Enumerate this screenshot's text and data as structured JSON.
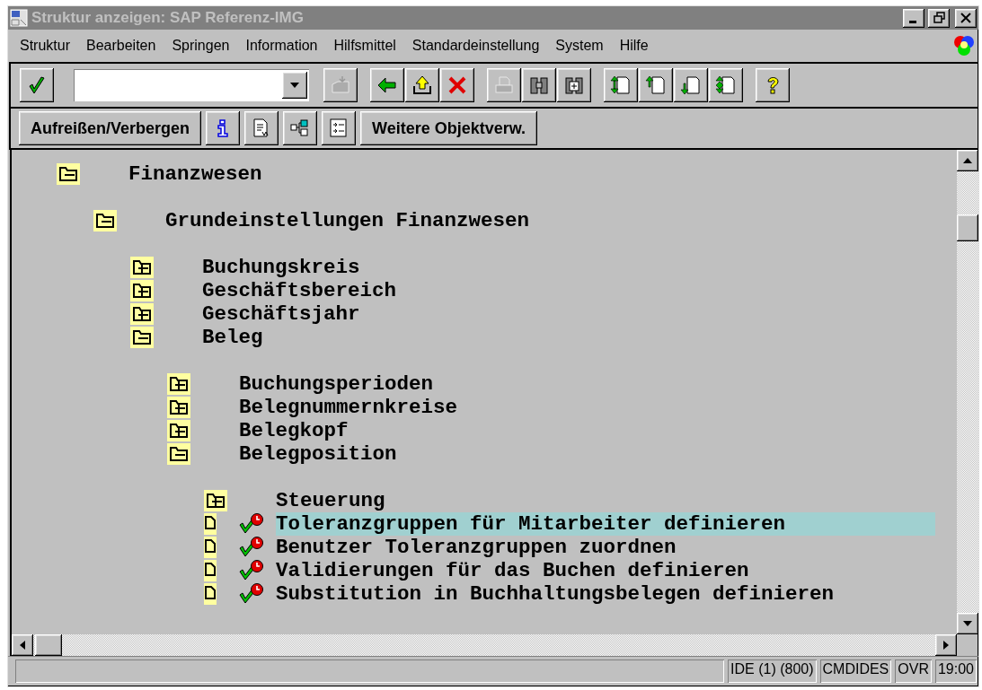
{
  "window": {
    "title": "Struktur anzeigen: SAP Referenz-IMG"
  },
  "menu": [
    {
      "label": "Struktur"
    },
    {
      "label": "Bearbeiten"
    },
    {
      "label": "Springen"
    },
    {
      "label": "Information"
    },
    {
      "label": "Hilfsmittel"
    },
    {
      "label": "Standardeinstellung"
    },
    {
      "label": "System"
    },
    {
      "label": "Hilfe"
    }
  ],
  "toolbar": [
    [
      {
        "kind": "enter",
        "disabled": false
      },
      {
        "kind": "command-field"
      },
      {
        "kind": "save",
        "disabled": true
      }
    ],
    [
      {
        "kind": "back",
        "disabled": false
      },
      {
        "kind": "exit",
        "disabled": false
      },
      {
        "kind": "cancel",
        "disabled": false
      }
    ],
    [
      {
        "kind": "print",
        "disabled": true
      },
      {
        "kind": "find",
        "disabled": false
      },
      {
        "kind": "find-next",
        "disabled": false
      }
    ],
    [
      {
        "kind": "first-page",
        "disabled": false
      },
      {
        "kind": "previous-page",
        "disabled": false
      },
      {
        "kind": "next-page",
        "disabled": false
      },
      {
        "kind": "last-page",
        "disabled": false
      }
    ],
    [
      {
        "kind": "help",
        "disabled": false
      }
    ]
  ],
  "app_toolbar": [
    {
      "kind": "text",
      "label": "Aufreißen/Verbergen"
    },
    {
      "kind": "info"
    },
    {
      "kind": "document"
    },
    {
      "kind": "hierarchy"
    },
    {
      "kind": "list"
    },
    {
      "kind": "text",
      "label": "Weitere Objektverw."
    }
  ],
  "tree": [
    {
      "kind": "folder",
      "label": "Finanzwesen",
      "expanded": true,
      "selected": false,
      "children": [
        {
          "kind": "folder",
          "label": "Grundeinstellungen Finanzwesen",
          "expanded": true,
          "selected": false,
          "children": [
            {
              "kind": "folder",
              "label": "Buchungskreis",
              "expanded": false,
              "selected": false
            },
            {
              "kind": "folder",
              "label": "Geschäftsbereich",
              "expanded": false,
              "selected": false
            },
            {
              "kind": "folder",
              "label": "Geschäftsjahr",
              "expanded": false,
              "selected": false
            },
            {
              "kind": "folder",
              "label": "Beleg",
              "expanded": true,
              "selected": false,
              "children": [
                {
                  "kind": "folder",
                  "label": "Buchungsperioden",
                  "expanded": false,
                  "selected": false
                },
                {
                  "kind": "folder",
                  "label": "Belegnummernkreise",
                  "expanded": false,
                  "selected": false
                },
                {
                  "kind": "folder",
                  "label": "Belegkopf",
                  "expanded": false,
                  "selected": false
                },
                {
                  "kind": "folder",
                  "label": "Belegposition",
                  "expanded": true,
                  "selected": false,
                  "children": [
                    {
                      "kind": "folder",
                      "label": "Steuerung",
                      "expanded": false,
                      "selected": false
                    },
                    {
                      "kind": "activity",
                      "label": "Toleranzgruppen für Mitarbeiter definieren",
                      "selected": true
                    },
                    {
                      "kind": "activity",
                      "label": "Benutzer Toleranzgruppen zuordnen",
                      "selected": false
                    },
                    {
                      "kind": "activity",
                      "label": "Validierungen für das Buchen definieren",
                      "selected": false
                    },
                    {
                      "kind": "activity",
                      "label": "Substitution in Buchhaltungsbelegen definieren",
                      "selected": false
                    }
                  ]
                }
              ]
            }
          ]
        }
      ]
    }
  ],
  "status_bar": {
    "fields": [
      "IDE (1) (800)",
      "CMDIDES",
      "OVR",
      "19:00"
    ]
  }
}
